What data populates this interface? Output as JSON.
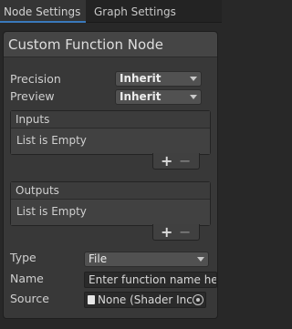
{
  "tabs": [
    {
      "label": "Node Settings",
      "active": true
    },
    {
      "label": "Graph Settings",
      "active": false
    }
  ],
  "panel": {
    "title": "Custom Function Node",
    "precision": {
      "label": "Precision",
      "value": "Inherit"
    },
    "preview": {
      "label": "Preview",
      "value": "Inherit"
    },
    "inputs": {
      "header": "Inputs",
      "empty_text": "List is Empty",
      "add": "+",
      "remove": "−"
    },
    "outputs": {
      "header": "Outputs",
      "empty_text": "List is Empty",
      "add": "+",
      "remove": "−"
    },
    "type": {
      "label": "Type",
      "value": "File"
    },
    "name": {
      "label": "Name",
      "placeholder": "Enter function name here..."
    },
    "source": {
      "label": "Source",
      "value": "None (Shader Inc"
    }
  },
  "colors": {
    "accent": "#3a79bb",
    "panel": "#383838",
    "background": "#282828"
  },
  "icons": {
    "file": "file-icon",
    "picker": "object-picker-icon",
    "dropdown": "chevron-down-icon"
  }
}
